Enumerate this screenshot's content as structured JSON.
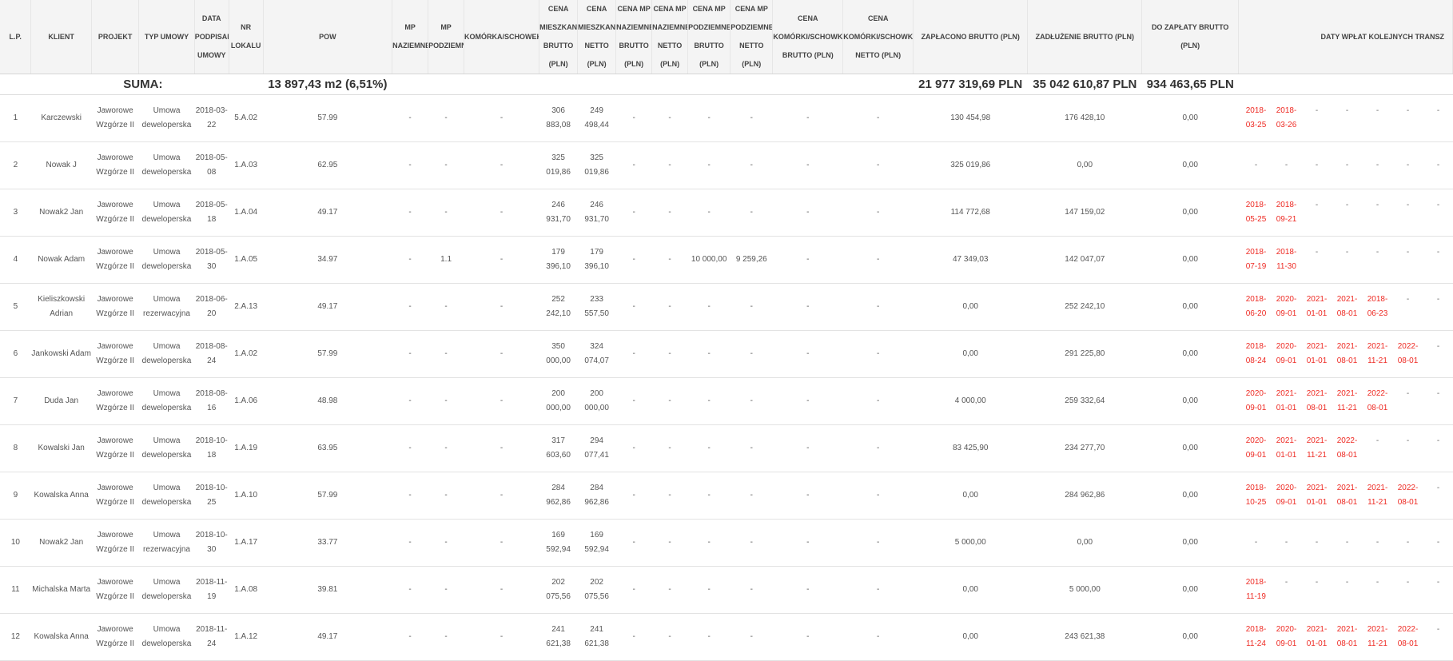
{
  "headers": [
    "L.P.",
    "KLIENT",
    "PROJEKT",
    "TYP UMOWY",
    "DATA PODPISANIA UMOWY",
    "NR LOKALU",
    "POW",
    "MP NAZIEMNE",
    "MP PODZIEMNE",
    "KOMÓRKA/SCHOWEK",
    "CENA MIESZKANIA BRUTTO (PLN)",
    "CENA MIESZKANIA NETTO (PLN)",
    "CENA MP NAZIEMNE BRUTTO (PLN)",
    "CENA MP NAZIEMNE NETTO (PLN)",
    "CENA MP PODZIEMNE BRUTTO (PLN)",
    "CENA MP PODZIEMNE NETTO (PLN)",
    "CENA KOMÓRKI/SCHOWKA BRUTTO (PLN)",
    "CENA KOMÓRKI/SCHOWKA NETTO (PLN)",
    "ZAPŁACONO BRUTTO (PLN)",
    "ZADŁUŻENIE BRUTTO (PLN)",
    "DO ZAPŁATY BRUTTO (PLN)",
    "DATY WPŁAT KOLEJNYCH TRANSZ"
  ],
  "summary": {
    "label": "SUMA:",
    "pow": "13 897,43 m2 (6,51%)",
    "paid": "21 977 319,69 PLN",
    "debt": "35 042 610,87 PLN",
    "due": "934 463,65 PLN"
  },
  "rows": [
    {
      "lp": "1",
      "client": "Karczewski",
      "project": "Jaworowe Wzgórze II",
      "type": "Umowa deweloperska",
      "date": "2018-03-22",
      "unit": "5.A.02",
      "pow": "57.99",
      "mpn": "-",
      "mpp": "-",
      "kom": "-",
      "cmb": "306 883,08",
      "cmn": "249 498,44",
      "cmpnb": "-",
      "cmpnn": "-",
      "cmppb": "-",
      "cmppn": "-",
      "ckb": "-",
      "ckn": "-",
      "paid": "130 454,98",
      "debt": "176 428,10",
      "due": "0,00",
      "tranches": [
        {
          "t": "2018-03-25",
          "red": true
        },
        {
          "t": "2018-03-26",
          "red": true
        },
        {
          "t": "-"
        },
        {
          "t": "-"
        },
        {
          "t": "-"
        },
        {
          "t": "-"
        },
        {
          "t": "-"
        }
      ]
    },
    {
      "lp": "2",
      "client": "Nowak J",
      "project": "Jaworowe Wzgórze II",
      "type": "Umowa deweloperska",
      "date": "2018-05-08",
      "unit": "1.A.03",
      "pow": "62.95",
      "mpn": "-",
      "mpp": "-",
      "kom": "-",
      "cmb": "325 019,86",
      "cmn": "325 019,86",
      "cmpnb": "-",
      "cmpnn": "-",
      "cmppb": "-",
      "cmppn": "-",
      "ckb": "-",
      "ckn": "-",
      "paid": "325 019,86",
      "debt": "0,00",
      "due": "0,00",
      "tranches": [
        {
          "t": "-"
        },
        {
          "t": "-"
        },
        {
          "t": "-"
        },
        {
          "t": "-"
        },
        {
          "t": "-"
        },
        {
          "t": "-"
        },
        {
          "t": "-"
        }
      ]
    },
    {
      "lp": "3",
      "client": "Nowak2 Jan",
      "project": "Jaworowe Wzgórze II",
      "type": "Umowa deweloperska",
      "date": "2018-05-18",
      "unit": "1.A.04",
      "pow": "49.17",
      "mpn": "-",
      "mpp": "-",
      "kom": "-",
      "cmb": "246 931,70",
      "cmn": "246 931,70",
      "cmpnb": "-",
      "cmpnn": "-",
      "cmppb": "-",
      "cmppn": "-",
      "ckb": "-",
      "ckn": "-",
      "paid": "114 772,68",
      "debt": "147 159,02",
      "due": "0,00",
      "tranches": [
        {
          "t": "2018-05-25",
          "red": true
        },
        {
          "t": "2018-09-21",
          "red": true
        },
        {
          "t": "-"
        },
        {
          "t": "-"
        },
        {
          "t": "-"
        },
        {
          "t": "-"
        },
        {
          "t": "-"
        }
      ]
    },
    {
      "lp": "4",
      "client": "Nowak Adam",
      "project": "Jaworowe Wzgórze II",
      "type": "Umowa deweloperska",
      "date": "2018-05-30",
      "unit": "1.A.05",
      "pow": "34.97",
      "mpn": "-",
      "mpp": "1.1",
      "kom": "-",
      "cmb": "179 396,10",
      "cmn": "179 396,10",
      "cmpnb": "-",
      "cmpnn": "-",
      "cmppb": "10 000,00",
      "cmppn": "9 259,26",
      "ckb": "-",
      "ckn": "-",
      "paid": "47 349,03",
      "debt": "142 047,07",
      "due": "0,00",
      "tranches": [
        {
          "t": "2018-07-19",
          "red": true
        },
        {
          "t": "2018-11-30",
          "red": true
        },
        {
          "t": "-"
        },
        {
          "t": "-"
        },
        {
          "t": "-"
        },
        {
          "t": "-"
        },
        {
          "t": "-"
        }
      ]
    },
    {
      "lp": "5",
      "client": "Kieliszkowski Adrian",
      "project": "Jaworowe Wzgórze II",
      "type": "Umowa rezerwacyjna",
      "date": "2018-06-20",
      "unit": "2.A.13",
      "pow": "49.17",
      "mpn": "-",
      "mpp": "-",
      "kom": "-",
      "cmb": "252 242,10",
      "cmn": "233 557,50",
      "cmpnb": "-",
      "cmpnn": "-",
      "cmppb": "-",
      "cmppn": "-",
      "ckb": "-",
      "ckn": "-",
      "paid": "0,00",
      "debt": "252 242,10",
      "due": "0,00",
      "tranches": [
        {
          "t": "2018-06-20",
          "red": true
        },
        {
          "t": "2020-09-01",
          "red": true
        },
        {
          "t": "2021-01-01",
          "red": true
        },
        {
          "t": "2021-08-01",
          "red": true
        },
        {
          "t": "2018-06-23",
          "red": true
        },
        {
          "t": "-"
        },
        {
          "t": "-"
        }
      ]
    },
    {
      "lp": "6",
      "client": "Jankowski Adam",
      "project": "Jaworowe Wzgórze II",
      "type": "Umowa deweloperska",
      "date": "2018-08-24",
      "unit": "1.A.02",
      "pow": "57.99",
      "mpn": "-",
      "mpp": "-",
      "kom": "-",
      "cmb": "350 000,00",
      "cmn": "324 074,07",
      "cmpnb": "-",
      "cmpnn": "-",
      "cmppb": "-",
      "cmppn": "-",
      "ckb": "-",
      "ckn": "-",
      "paid": "0,00",
      "debt": "291 225,80",
      "due": "0,00",
      "tranches": [
        {
          "t": "2018-08-24",
          "red": true
        },
        {
          "t": "2020-09-01",
          "red": true
        },
        {
          "t": "2021-01-01",
          "red": true
        },
        {
          "t": "2021-08-01",
          "red": true
        },
        {
          "t": "2021-11-21",
          "red": true
        },
        {
          "t": "2022-08-01",
          "red": true
        },
        {
          "t": "-"
        }
      ]
    },
    {
      "lp": "7",
      "client": "Duda Jan",
      "project": "Jaworowe Wzgórze II",
      "type": "Umowa deweloperska",
      "date": "2018-08-16",
      "unit": "1.A.06",
      "pow": "48.98",
      "mpn": "-",
      "mpp": "-",
      "kom": "-",
      "cmb": "200 000,00",
      "cmn": "200 000,00",
      "cmpnb": "-",
      "cmpnn": "-",
      "cmppb": "-",
      "cmppn": "-",
      "ckb": "-",
      "ckn": "-",
      "paid": "4 000,00",
      "debt": "259 332,64",
      "due": "0,00",
      "tranches": [
        {
          "t": "2020-09-01",
          "red": true
        },
        {
          "t": "2021-01-01",
          "red": true
        },
        {
          "t": "2021-08-01",
          "red": true
        },
        {
          "t": "2021-11-21",
          "red": true
        },
        {
          "t": "2022-08-01",
          "red": true
        },
        {
          "t": "-"
        },
        {
          "t": "-"
        }
      ]
    },
    {
      "lp": "8",
      "client": "Kowalski Jan",
      "project": "Jaworowe Wzgórze II",
      "type": "Umowa deweloperska",
      "date": "2018-10-18",
      "unit": "1.A.19",
      "pow": "63.95",
      "mpn": "-",
      "mpp": "-",
      "kom": "-",
      "cmb": "317 603,60",
      "cmn": "294 077,41",
      "cmpnb": "-",
      "cmpnn": "-",
      "cmppb": "-",
      "cmppn": "-",
      "ckb": "-",
      "ckn": "-",
      "paid": "83 425,90",
      "debt": "234 277,70",
      "due": "0,00",
      "tranches": [
        {
          "t": "2020-09-01",
          "red": true
        },
        {
          "t": "2021-01-01",
          "red": true
        },
        {
          "t": "2021-11-21",
          "red": true
        },
        {
          "t": "2022-08-01",
          "red": true
        },
        {
          "t": "-"
        },
        {
          "t": "-"
        },
        {
          "t": "-"
        }
      ]
    },
    {
      "lp": "9",
      "client": "Kowalska Anna",
      "project": "Jaworowe Wzgórze II",
      "type": "Umowa deweloperska",
      "date": "2018-10-25",
      "unit": "1.A.10",
      "pow": "57.99",
      "mpn": "-",
      "mpp": "-",
      "kom": "-",
      "cmb": "284 962,86",
      "cmn": "284 962,86",
      "cmpnb": "-",
      "cmpnn": "-",
      "cmppb": "-",
      "cmppn": "-",
      "ckb": "-",
      "ckn": "-",
      "paid": "0,00",
      "debt": "284 962,86",
      "due": "0,00",
      "tranches": [
        {
          "t": "2018-10-25",
          "red": true
        },
        {
          "t": "2020-09-01",
          "red": true
        },
        {
          "t": "2021-01-01",
          "red": true
        },
        {
          "t": "2021-08-01",
          "red": true
        },
        {
          "t": "2021-11-21",
          "red": true
        },
        {
          "t": "2022-08-01",
          "red": true
        },
        {
          "t": "-"
        }
      ]
    },
    {
      "lp": "10",
      "client": "Nowak2 Jan",
      "project": "Jaworowe Wzgórze II",
      "type": "Umowa rezerwacyjna",
      "date": "2018-10-30",
      "unit": "1.A.17",
      "pow": "33.77",
      "mpn": "-",
      "mpp": "-",
      "kom": "-",
      "cmb": "169 592,94",
      "cmn": "169 592,94",
      "cmpnb": "-",
      "cmpnn": "-",
      "cmppb": "-",
      "cmppn": "-",
      "ckb": "-",
      "ckn": "-",
      "paid": "5 000,00",
      "debt": "0,00",
      "due": "0,00",
      "tranches": [
        {
          "t": "-"
        },
        {
          "t": "-"
        },
        {
          "t": "-"
        },
        {
          "t": "-"
        },
        {
          "t": "-"
        },
        {
          "t": "-"
        },
        {
          "t": "-"
        }
      ]
    },
    {
      "lp": "11",
      "client": "Michalska Marta",
      "project": "Jaworowe Wzgórze II",
      "type": "Umowa deweloperska",
      "date": "2018-11-19",
      "unit": "1.A.08",
      "pow": "39.81",
      "mpn": "-",
      "mpp": "-",
      "kom": "-",
      "cmb": "202 075,56",
      "cmn": "202 075,56",
      "cmpnb": "-",
      "cmpnn": "-",
      "cmppb": "-",
      "cmppn": "-",
      "ckb": "-",
      "ckn": "-",
      "paid": "0,00",
      "debt": "5 000,00",
      "due": "0,00",
      "tranches": [
        {
          "t": "2018-11-19",
          "red": true
        },
        {
          "t": "-"
        },
        {
          "t": "-"
        },
        {
          "t": "-"
        },
        {
          "t": "-"
        },
        {
          "t": "-"
        },
        {
          "t": "-"
        }
      ]
    },
    {
      "lp": "12",
      "client": "Kowalska Anna",
      "project": "Jaworowe Wzgórze II",
      "type": "Umowa deweloperska",
      "date": "2018-11-24",
      "unit": "1.A.12",
      "pow": "49.17",
      "mpn": "-",
      "mpp": "-",
      "kom": "-",
      "cmb": "241 621,38",
      "cmn": "241 621,38",
      "cmpnb": "-",
      "cmpnn": "-",
      "cmppb": "-",
      "cmppn": "-",
      "ckb": "-",
      "ckn": "-",
      "paid": "0,00",
      "debt": "243 621,38",
      "due": "0,00",
      "tranches": [
        {
          "t": "2018-11-24",
          "red": true
        },
        {
          "t": "2020-09-01",
          "red": true
        },
        {
          "t": "2021-01-01",
          "red": true
        },
        {
          "t": "2021-08-01",
          "red": true
        },
        {
          "t": "2021-11-21",
          "red": true
        },
        {
          "t": "2022-08-01",
          "red": true
        },
        {
          "t": "-"
        }
      ]
    }
  ]
}
